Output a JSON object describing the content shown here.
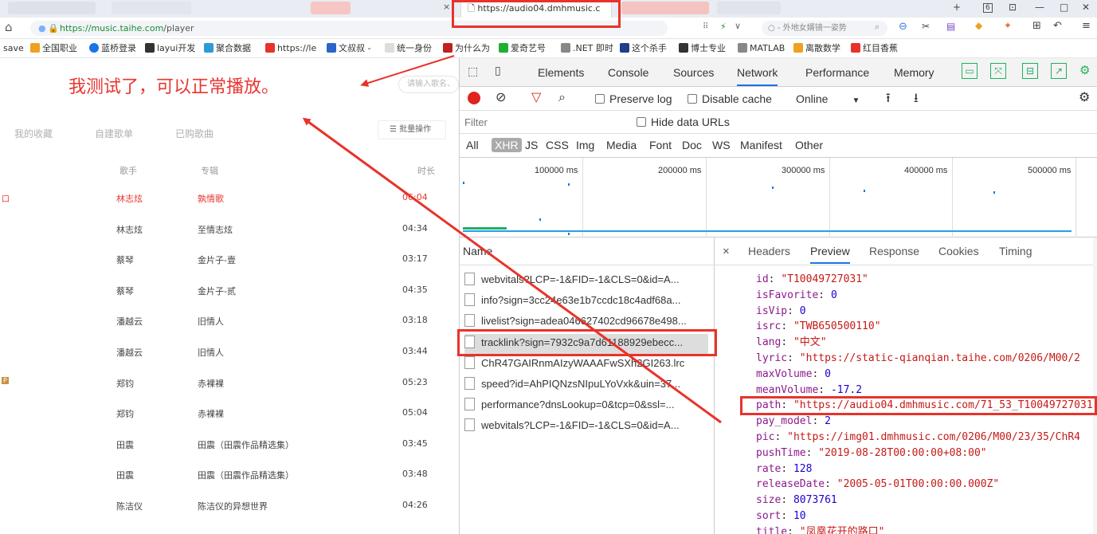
{
  "browser": {
    "active_tab_title": "https://audio04.dmhmusic.c",
    "tab_close_glyph": "×",
    "window_controls": [
      "+",
      "6",
      "⊡",
      "—",
      "□",
      "✕"
    ],
    "address_url_prefix": "https://",
    "address_url_host": "music.taihe.com",
    "address_url_path": "/player",
    "search_placeholder": "○ - 外地女婿镜一姿势",
    "bookmarks": [
      {
        "label": "save",
        "color": "#888888"
      },
      {
        "label": "全国职业",
        "color": "#f0a020"
      },
      {
        "label": "蓝桥登录",
        "color": "#1a73e8"
      },
      {
        "label": "layui开发",
        "color": "#333333"
      },
      {
        "label": "聚合数据",
        "color": "#2e9bd6"
      },
      {
        "label": "https://le",
        "color": "#e8332a"
      },
      {
        "label": "文叔叔 -",
        "color": "#2a66c8"
      },
      {
        "label": "统一身份",
        "color": "#bbbbbb"
      },
      {
        "label": "为什么为",
        "color": "#c02020"
      },
      {
        "label": "爱奇艺号",
        "color": "#20b030"
      },
      {
        "label": ".NET 即时",
        "color": "#666666"
      },
      {
        "label": "这个杀手",
        "color": "#1e3f8a"
      },
      {
        "label": "博士专业",
        "color": "#333333"
      },
      {
        "label": "MATLAB",
        "color": "#666666"
      },
      {
        "label": "离散数学",
        "color": "#f0a020"
      },
      {
        "label": "红目香蕉",
        "color": "#e8332a"
      }
    ]
  },
  "music_page": {
    "annotation": "我测试了，可以正常播放。",
    "search_placeholder": "请输入歌名、",
    "tabs": [
      "我的收藏",
      "自建歌单",
      "已购歌曲"
    ],
    "batch_button": "☰ 批量操作",
    "columns": {
      "artist": "歌手",
      "album": "专辑",
      "duration": "时长"
    },
    "rows": [
      {
        "mark": "口",
        "artist": "林志炫",
        "album": "孰情歌",
        "duration": "06:04",
        "active": true
      },
      {
        "mark": "",
        "artist": "林志炫",
        "album": "至情志炫",
        "duration": "04:34",
        "active": false
      },
      {
        "mark": "",
        "artist": "蔡琴",
        "album": "金片子-壹",
        "duration": "03:17",
        "active": false
      },
      {
        "mark": "",
        "artist": "蔡琴",
        "album": "金片子-贰",
        "duration": "04:35",
        "active": false
      },
      {
        "mark": "",
        "artist": "潘越云",
        "album": "旧情人",
        "duration": "03:18",
        "active": false
      },
      {
        "mark": "",
        "artist": "潘越云",
        "album": "旧情人",
        "duration": "03:44",
        "active": false
      },
      {
        "mark": "P",
        "artist": "郑钧",
        "album": "赤裸裸",
        "duration": "05:23",
        "active": false
      },
      {
        "mark": "",
        "artist": "郑钧",
        "album": "赤裸裸",
        "duration": "05:04",
        "active": false
      },
      {
        "mark": "",
        "artist": "田震",
        "album": "田震（田震作品精选集）",
        "duration": "03:45",
        "active": false
      },
      {
        "mark": "",
        "artist": "田震",
        "album": "田震（田震作品精选集）",
        "duration": "03:48",
        "active": false
      },
      {
        "mark": "",
        "artist": "陈洁仪",
        "album": "陈洁仪的异想世界",
        "duration": "04:26",
        "active": false
      }
    ]
  },
  "devtools": {
    "tabs": [
      "Elements",
      "Console",
      "Sources",
      "Network",
      "Performance",
      "Memory"
    ],
    "active_tab": "Network",
    "toolbar": {
      "preserve_log": "Preserve log",
      "disable_cache": "Disable cache",
      "throttle": "Online"
    },
    "filter_placeholder": "Filter",
    "hide_data_urls": "Hide data URLs",
    "type_filters": [
      "All",
      "XHR",
      "JS",
      "CSS",
      "Img",
      "Media",
      "Font",
      "Doc",
      "WS",
      "Manifest",
      "Other"
    ],
    "timeline_labels": [
      "100000 ms",
      "200000 ms",
      "300000 ms",
      "400000 ms",
      "500000 ms"
    ],
    "name_header": "Name",
    "requests": [
      "webvitals?LCP=-1&FID=-1&CLS=0&id=A...",
      "info?sign=3cc24e63e1b7ccdc18c4adf68a...",
      "livelist?sign=adea046627402cd96678e498...",
      "tracklink?sign=7932c9a7d61188929ebecc...",
      "ChR47GAIRnmAIzyWAAAFwSXh2GI263.lrc",
      "speed?id=AhPIQNzsNIpuLYoVxk&uin=37...",
      "performance?dnsLookup=0&tcp=0&ssl=...",
      "webvitals?LCP=-1&FID=-1&CLS=0&id=A..."
    ],
    "selected_request": 3,
    "detail_close": "×",
    "detail_tabs": [
      "Headers",
      "Preview",
      "Response",
      "Cookies",
      "Timing"
    ],
    "preview": [
      {
        "key": "id",
        "value": "\"T10049727031\"",
        "type": "s"
      },
      {
        "key": "isFavorite",
        "value": "0",
        "type": "n"
      },
      {
        "key": "isVip",
        "value": "0",
        "type": "n"
      },
      {
        "key": "isrc",
        "value": "\"TWB650500110\"",
        "type": "s"
      },
      {
        "key": "lang",
        "value": "\"中文\"",
        "type": "s"
      },
      {
        "key": "lyric",
        "value": "\"https://static-qianqian.taihe.com/0206/M00/2",
        "type": "s"
      },
      {
        "key": "maxVolume",
        "value": "0",
        "type": "n"
      },
      {
        "key": "meanVolume",
        "value": "-17.2",
        "type": "n"
      },
      {
        "key": "path",
        "value": "\"https://audio04.dmhmusic.com/71_53_T10049727031",
        "type": "s"
      },
      {
        "key": "pay_model",
        "value": "2",
        "type": "n"
      },
      {
        "key": "pic",
        "value": "\"https://img01.dmhmusic.com/0206/M00/23/35/ChR4",
        "type": "s"
      },
      {
        "key": "pushTime",
        "value": "\"2019-08-28T00:00:00+08:00\"",
        "type": "s"
      },
      {
        "key": "rate",
        "value": "128",
        "type": "n"
      },
      {
        "key": "releaseDate",
        "value": "\"2005-05-01T00:00:00.000Z\"",
        "type": "s"
      },
      {
        "key": "size",
        "value": "8073761",
        "type": "n"
      },
      {
        "key": "sort",
        "value": "10",
        "type": "n"
      },
      {
        "key": "title",
        "value": "\"凤凰花开的路口\"",
        "type": "s"
      }
    ]
  },
  "colors": {
    "accent_red": "#e8332a",
    "link_blue": "#1a73e8",
    "url_green": "#1a8d34"
  }
}
